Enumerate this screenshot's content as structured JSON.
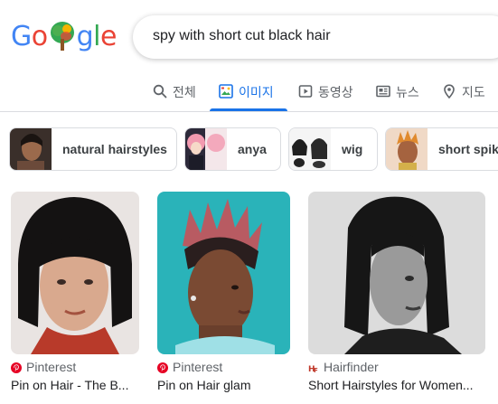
{
  "logo": {
    "letters": [
      "G",
      "o",
      "",
      "g",
      "l",
      "e"
    ],
    "colors": [
      "#4285f4",
      "#ea4335",
      "",
      "#4285f4",
      "#34a853",
      "#ea4335"
    ]
  },
  "search": {
    "query": "spy with short cut black hair"
  },
  "tabs": [
    {
      "label": "전체",
      "icon": "search-icon",
      "active": false
    },
    {
      "label": "이미지",
      "icon": "image-icon",
      "active": true
    },
    {
      "label": "동영상",
      "icon": "video-icon",
      "active": false
    },
    {
      "label": "뉴스",
      "icon": "news-icon",
      "active": false
    },
    {
      "label": "지도",
      "icon": "map-pin-icon",
      "active": false
    }
  ],
  "chips": [
    {
      "label": "natural hairstyles"
    },
    {
      "label": "anya"
    },
    {
      "label": "wig"
    },
    {
      "label": "short spiky"
    }
  ],
  "results": [
    {
      "source": "Pinterest",
      "title": "Pin on Hair - The B...",
      "source_icon": "pinterest-icon"
    },
    {
      "source": "Pinterest",
      "title": "Pin on Hair glam",
      "source_icon": "pinterest-icon"
    },
    {
      "source": "Hairfinder",
      "title": "Short Hairstyles for Women...",
      "source_icon": "hairfinder-icon"
    }
  ],
  "colors": {
    "accent": "#1a73e8",
    "pinterest": "#e60023",
    "hairfinder": "#c0392b"
  }
}
